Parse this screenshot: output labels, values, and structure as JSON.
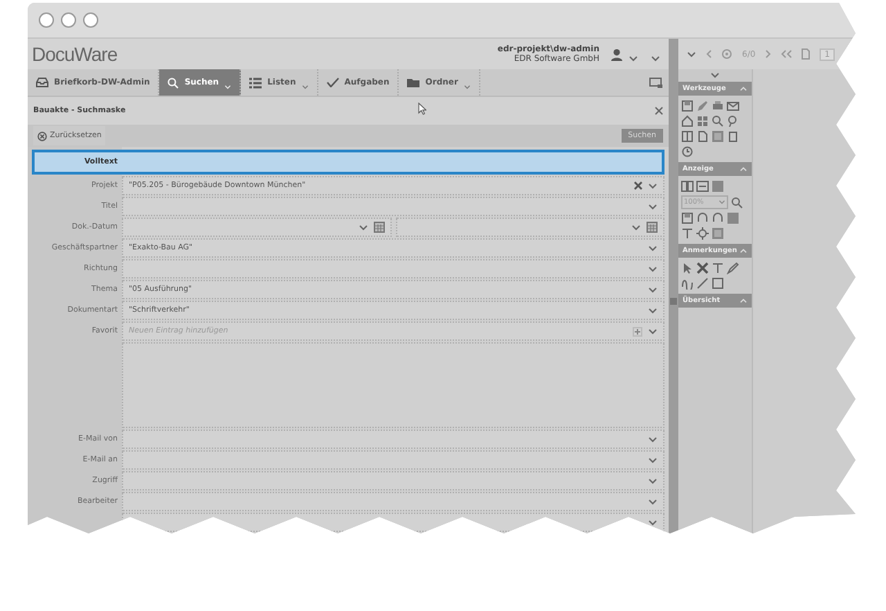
{
  "header": {
    "logo": "DocuWare",
    "user": "edr-projekt\\dw-admin",
    "company": "EDR Software GmbH"
  },
  "nav_tabs": [
    {
      "label": "Briefkorb-DW-Admin",
      "selected": false,
      "has_menu": false
    },
    {
      "label": "Suchen",
      "selected": true,
      "has_menu": true
    },
    {
      "label": "Listen",
      "selected": false,
      "has_menu": true
    },
    {
      "label": "Aufgaben",
      "selected": false,
      "has_menu": false
    },
    {
      "label": "Ordner",
      "selected": false,
      "has_menu": true
    }
  ],
  "dialog": {
    "title": "Bauakte - Suchmaske",
    "reset_button": "Zurücksetzen",
    "search_button": "Suchen"
  },
  "fields": [
    {
      "label": "Volltext",
      "kind": "text",
      "focused": true
    },
    {
      "label": "Projekt",
      "kind": "combo",
      "value": "\"P05.205 - Bürogebäude Downtown München\"",
      "clearable": true,
      "focused": false
    },
    {
      "label": "Titel",
      "kind": "combo",
      "focused": false
    },
    {
      "label": "Dok.-Datum",
      "kind": "date",
      "focused": false
    },
    {
      "label": "Geschäftspartner",
      "kind": "combo",
      "value": "\"Exakto-Bau AG\"",
      "focused": false
    },
    {
      "label": "Richtung",
      "kind": "combo",
      "focused": false
    },
    {
      "label": "Thema",
      "kind": "combo",
      "value": "\"05 Ausführung\"",
      "focused": false
    },
    {
      "label": "Dokumentart",
      "kind": "combo",
      "value": "\"Schriftverkehr\"",
      "focused": false
    },
    {
      "label": "Favorit",
      "kind": "multi",
      "placeholder": "Neuen Eintrag hinzufügen",
      "focused": false
    },
    {
      "label": "E-Mail von",
      "kind": "combo",
      "focused": false
    },
    {
      "label": "E-Mail an",
      "kind": "combo",
      "focused": false
    },
    {
      "label": "Zugriff",
      "kind": "combo",
      "focused": false
    },
    {
      "label": "Bearbeiter",
      "kind": "combo",
      "focused": false
    },
    {
      "kind": "combo",
      "focused": false
    }
  ],
  "viewer": {
    "page_count": "6/0",
    "page_number": "1",
    "sections": [
      {
        "title": "Werkzeuge",
        "expanded": true,
        "kind": "tools"
      },
      {
        "title": "Anzeige",
        "expanded": true,
        "kind": "view",
        "zoom": "100%"
      },
      {
        "title": "Anmerkungen",
        "expanded": true,
        "kind": "annotations"
      },
      {
        "title": "Übersicht",
        "expanded": true,
        "kind": "overview"
      }
    ]
  }
}
